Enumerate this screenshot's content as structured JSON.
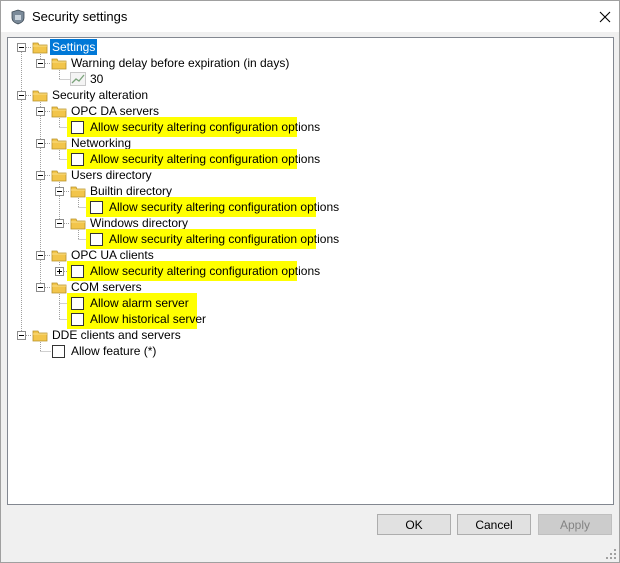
{
  "window": {
    "title": "Security settings"
  },
  "tree": {
    "settings": "Settings",
    "warning_delay": "Warning delay before expiration (in days)",
    "warning_value": "30",
    "security_alteration": "Security alteration",
    "opc_da_servers": "OPC DA servers",
    "opc_da_allow": "Allow security altering configuration options",
    "networking": "Networking",
    "networking_allow": "Allow security altering configuration options",
    "users_directory": "Users directory",
    "builtin_directory": "Builtin directory",
    "builtin_allow": "Allow security altering configuration options",
    "windows_directory": "Windows directory",
    "windows_allow": "Allow security altering configuration options",
    "opc_ua_clients": "OPC UA clients",
    "opc_ua_allow": "Allow security altering configuration options",
    "com_servers": "COM servers",
    "com_alarm": "Allow alarm server",
    "com_historical": "Allow historical server",
    "dde": "DDE clients and servers",
    "dde_allow": "Allow feature (*)"
  },
  "buttons": {
    "ok": "OK",
    "cancel": "Cancel",
    "apply": "Apply"
  },
  "colors": {
    "highlight": "#ffff00",
    "selection": "#0078d7",
    "folder": "#f2c54b"
  },
  "icons": {
    "title": "security-shield-icon",
    "close": "close-icon",
    "folder": "folder-icon",
    "value": "chart-value-icon",
    "grip": "resize-grip-icon"
  }
}
